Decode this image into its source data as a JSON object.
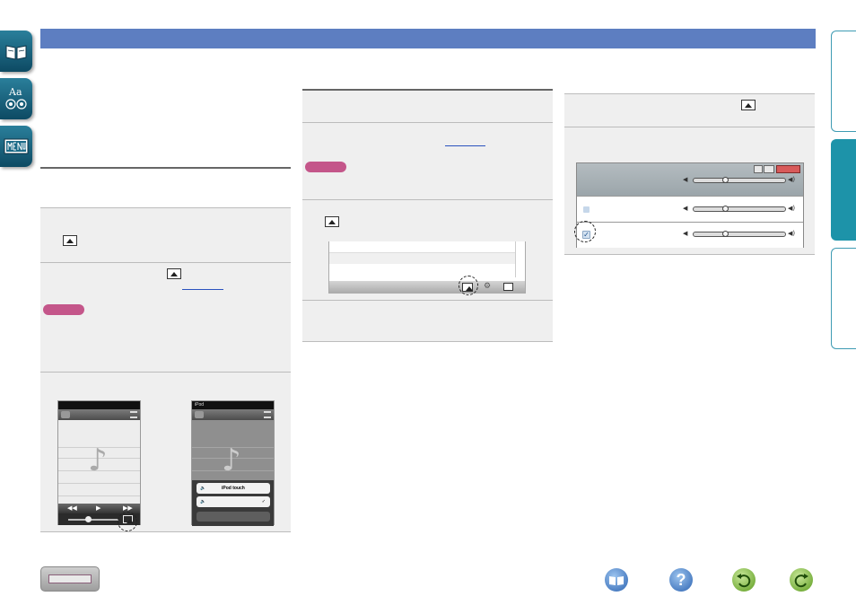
{
  "screen2": {
    "status": "iPod",
    "menu_item": "iPod touch",
    "checkmark": "✓"
  },
  "bottom_nav": {
    "help_glyph": "?"
  },
  "colors": {
    "top_bar": "#5d7ec1",
    "active_side_tab": "#1d93a9",
    "note_badge": "#c4568a"
  }
}
